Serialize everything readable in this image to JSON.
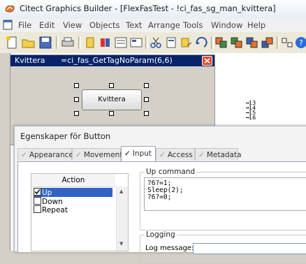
{
  "window": {
    "title": "Citect Graphics Builder - [FlexFasTest - !ci_fas_sg_man_kvittera]"
  },
  "menu": [
    "File",
    "Edit",
    "View",
    "Objects",
    "Text",
    "Arrange",
    "Tools",
    "Window",
    "Help"
  ],
  "toolbar": {
    "buttons": [
      "new-icon",
      "open-icon",
      "save-icon",
      "print-icon",
      "copy-icon",
      "paste-icon",
      "page-icon",
      "grid-icon",
      "cut-icon",
      "page-props-icon",
      "undo-icon",
      "redo-icon",
      "group-icon",
      "ungroup-icon",
      "front-icon",
      "back-icon",
      "align-icon",
      "distribute-icon",
      "help-icon"
    ]
  },
  "properties_panel": {
    "name": "Kvittera",
    "expression": "=ci_fas_GetTagNoParam(6,6)"
  },
  "canvas": {
    "button_label": "Kvittera",
    "ruler_numbers": [
      "13",
      "14",
      "15",
      "16"
    ]
  },
  "dialog": {
    "title": "Egenskaper för Button",
    "tabs": [
      {
        "label": "Appearance",
        "checked": true,
        "active": false
      },
      {
        "label": "Movement",
        "checked": true,
        "active": false
      },
      {
        "label": "Input",
        "checked": true,
        "active": true
      },
      {
        "label": "Access",
        "checked": true,
        "active": false
      },
      {
        "label": "Metadata",
        "checked": false,
        "active": false
      }
    ],
    "action": {
      "header": "Action",
      "items": [
        {
          "label": "Up",
          "checked": true,
          "selected": true
        },
        {
          "label": "Down",
          "checked": false,
          "selected": false
        },
        {
          "label": "Repeat",
          "checked": false,
          "selected": false
        }
      ]
    },
    "up_command": {
      "label": "Up command",
      "lines": [
        "?6?=1;",
        "Sleep(2);",
        "?6?=0;"
      ]
    },
    "logging": {
      "label": "Logging",
      "log_message_label": "Log message:"
    }
  },
  "colors": {
    "accent": "#0a246a",
    "selection": "#3163c5",
    "close": "#e04f2f"
  }
}
